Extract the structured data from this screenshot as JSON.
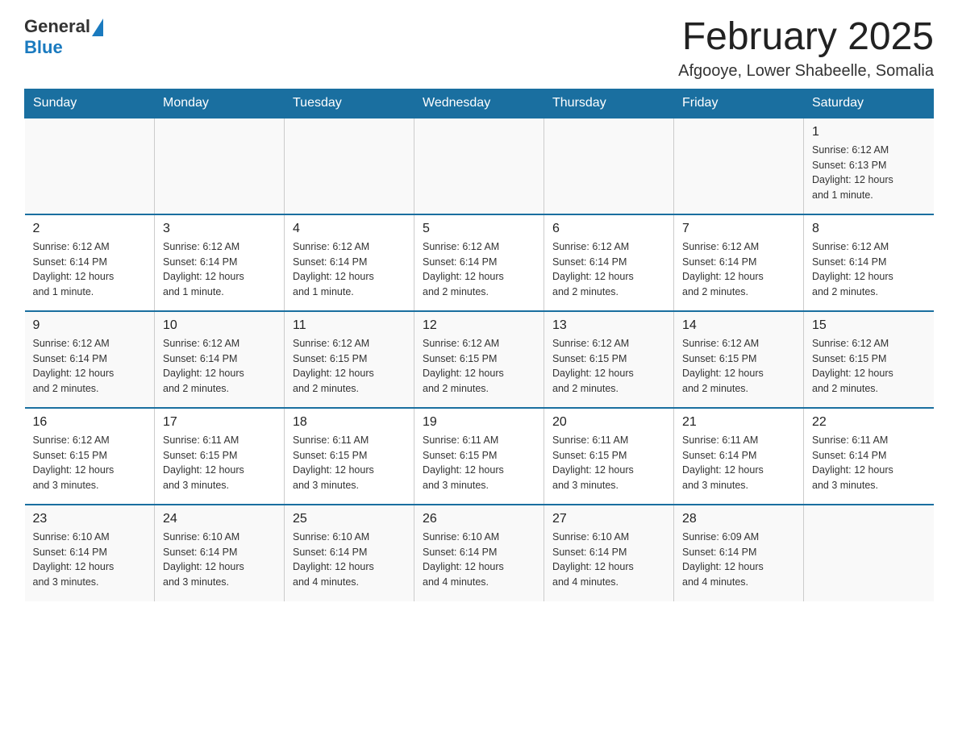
{
  "header": {
    "logo_general": "General",
    "logo_blue": "Blue",
    "month_title": "February 2025",
    "location": "Afgooye, Lower Shabeelle, Somalia"
  },
  "days_of_week": [
    "Sunday",
    "Monday",
    "Tuesday",
    "Wednesday",
    "Thursday",
    "Friday",
    "Saturday"
  ],
  "weeks": [
    [
      {
        "day": "",
        "info": ""
      },
      {
        "day": "",
        "info": ""
      },
      {
        "day": "",
        "info": ""
      },
      {
        "day": "",
        "info": ""
      },
      {
        "day": "",
        "info": ""
      },
      {
        "day": "",
        "info": ""
      },
      {
        "day": "1",
        "info": "Sunrise: 6:12 AM\nSunset: 6:13 PM\nDaylight: 12 hours\nand 1 minute."
      }
    ],
    [
      {
        "day": "2",
        "info": "Sunrise: 6:12 AM\nSunset: 6:14 PM\nDaylight: 12 hours\nand 1 minute."
      },
      {
        "day": "3",
        "info": "Sunrise: 6:12 AM\nSunset: 6:14 PM\nDaylight: 12 hours\nand 1 minute."
      },
      {
        "day": "4",
        "info": "Sunrise: 6:12 AM\nSunset: 6:14 PM\nDaylight: 12 hours\nand 1 minute."
      },
      {
        "day": "5",
        "info": "Sunrise: 6:12 AM\nSunset: 6:14 PM\nDaylight: 12 hours\nand 2 minutes."
      },
      {
        "day": "6",
        "info": "Sunrise: 6:12 AM\nSunset: 6:14 PM\nDaylight: 12 hours\nand 2 minutes."
      },
      {
        "day": "7",
        "info": "Sunrise: 6:12 AM\nSunset: 6:14 PM\nDaylight: 12 hours\nand 2 minutes."
      },
      {
        "day": "8",
        "info": "Sunrise: 6:12 AM\nSunset: 6:14 PM\nDaylight: 12 hours\nand 2 minutes."
      }
    ],
    [
      {
        "day": "9",
        "info": "Sunrise: 6:12 AM\nSunset: 6:14 PM\nDaylight: 12 hours\nand 2 minutes."
      },
      {
        "day": "10",
        "info": "Sunrise: 6:12 AM\nSunset: 6:14 PM\nDaylight: 12 hours\nand 2 minutes."
      },
      {
        "day": "11",
        "info": "Sunrise: 6:12 AM\nSunset: 6:15 PM\nDaylight: 12 hours\nand 2 minutes."
      },
      {
        "day": "12",
        "info": "Sunrise: 6:12 AM\nSunset: 6:15 PM\nDaylight: 12 hours\nand 2 minutes."
      },
      {
        "day": "13",
        "info": "Sunrise: 6:12 AM\nSunset: 6:15 PM\nDaylight: 12 hours\nand 2 minutes."
      },
      {
        "day": "14",
        "info": "Sunrise: 6:12 AM\nSunset: 6:15 PM\nDaylight: 12 hours\nand 2 minutes."
      },
      {
        "day": "15",
        "info": "Sunrise: 6:12 AM\nSunset: 6:15 PM\nDaylight: 12 hours\nand 2 minutes."
      }
    ],
    [
      {
        "day": "16",
        "info": "Sunrise: 6:12 AM\nSunset: 6:15 PM\nDaylight: 12 hours\nand 3 minutes."
      },
      {
        "day": "17",
        "info": "Sunrise: 6:11 AM\nSunset: 6:15 PM\nDaylight: 12 hours\nand 3 minutes."
      },
      {
        "day": "18",
        "info": "Sunrise: 6:11 AM\nSunset: 6:15 PM\nDaylight: 12 hours\nand 3 minutes."
      },
      {
        "day": "19",
        "info": "Sunrise: 6:11 AM\nSunset: 6:15 PM\nDaylight: 12 hours\nand 3 minutes."
      },
      {
        "day": "20",
        "info": "Sunrise: 6:11 AM\nSunset: 6:15 PM\nDaylight: 12 hours\nand 3 minutes."
      },
      {
        "day": "21",
        "info": "Sunrise: 6:11 AM\nSunset: 6:14 PM\nDaylight: 12 hours\nand 3 minutes."
      },
      {
        "day": "22",
        "info": "Sunrise: 6:11 AM\nSunset: 6:14 PM\nDaylight: 12 hours\nand 3 minutes."
      }
    ],
    [
      {
        "day": "23",
        "info": "Sunrise: 6:10 AM\nSunset: 6:14 PM\nDaylight: 12 hours\nand 3 minutes."
      },
      {
        "day": "24",
        "info": "Sunrise: 6:10 AM\nSunset: 6:14 PM\nDaylight: 12 hours\nand 3 minutes."
      },
      {
        "day": "25",
        "info": "Sunrise: 6:10 AM\nSunset: 6:14 PM\nDaylight: 12 hours\nand 4 minutes."
      },
      {
        "day": "26",
        "info": "Sunrise: 6:10 AM\nSunset: 6:14 PM\nDaylight: 12 hours\nand 4 minutes."
      },
      {
        "day": "27",
        "info": "Sunrise: 6:10 AM\nSunset: 6:14 PM\nDaylight: 12 hours\nand 4 minutes."
      },
      {
        "day": "28",
        "info": "Sunrise: 6:09 AM\nSunset: 6:14 PM\nDaylight: 12 hours\nand 4 minutes."
      },
      {
        "day": "",
        "info": ""
      }
    ]
  ]
}
